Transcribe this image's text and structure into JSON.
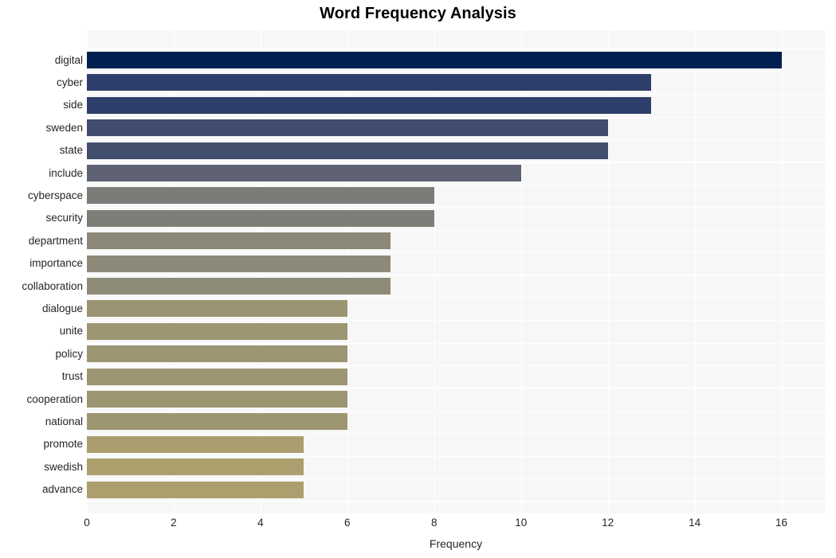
{
  "chart_data": {
    "type": "bar",
    "orientation": "horizontal",
    "title": "Word Frequency Analysis",
    "xlabel": "Frequency",
    "ylabel": "",
    "categories": [
      "digital",
      "cyber",
      "side",
      "sweden",
      "state",
      "include",
      "cyberspace",
      "security",
      "department",
      "importance",
      "collaboration",
      "dialogue",
      "unite",
      "policy",
      "trust",
      "cooperation",
      "national",
      "promote",
      "swedish",
      "advance"
    ],
    "values": [
      16,
      13,
      13,
      12,
      12,
      10,
      8,
      8,
      7,
      7,
      7,
      6,
      6,
      6,
      6,
      6,
      6,
      5,
      5,
      5
    ],
    "xlim": [
      0,
      17
    ],
    "xticks": [
      0,
      2,
      4,
      6,
      8,
      10,
      12,
      14,
      16
    ],
    "xtick_labels": [
      "0",
      "2",
      "4",
      "6",
      "8",
      "10",
      "12",
      "14",
      "16"
    ],
    "grid": true,
    "legend": false,
    "bar_colors": [
      "#012051",
      "#2f3f6b",
      "#2f3f6b",
      "#404d6e",
      "#424e6d",
      "#5e6272",
      "#7c7b78",
      "#7e7d78",
      "#8b8878",
      "#8d8a79",
      "#8f8b79",
      "#9b9472",
      "#9c9571",
      "#9c9571",
      "#9d9571",
      "#9d9571",
      "#9e9671",
      "#ab9e6e",
      "#ac9f6e",
      "#ac9f6e"
    ],
    "plot_background": "#f7f7f7",
    "grid_color": "#ffffff",
    "figure_background": "#ffffff"
  }
}
